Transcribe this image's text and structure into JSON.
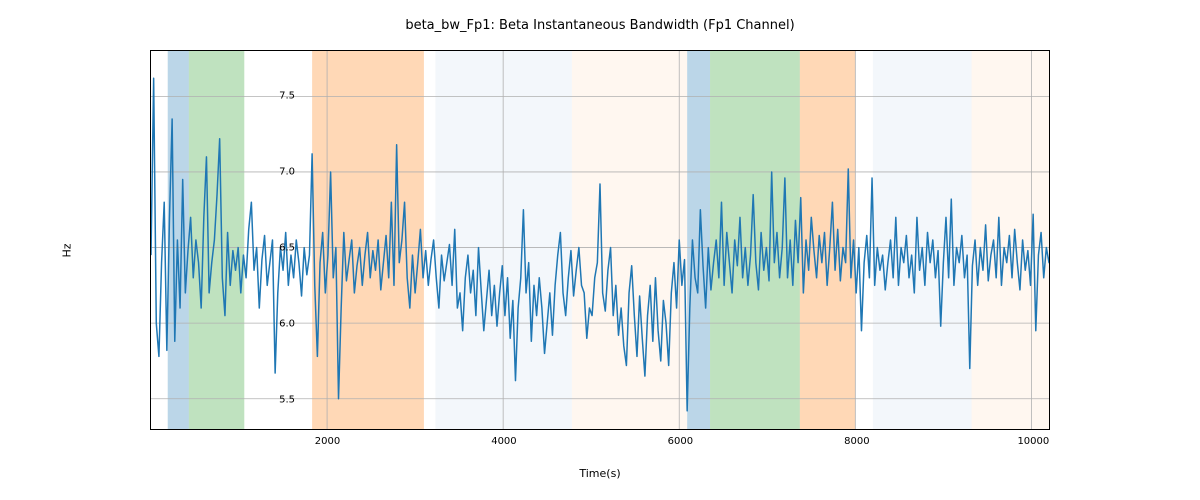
{
  "chart_data": {
    "type": "line",
    "title": "beta_bw_Fp1: Beta Instantaneous Bandwidth (Fp1 Channel)",
    "xlabel": "Time(s)",
    "ylabel": "Hz",
    "xlim": [
      0,
      10200
    ],
    "ylim": [
      5.3,
      7.8
    ],
    "xticks": [
      2000,
      4000,
      6000,
      8000,
      10000
    ],
    "yticks": [
      5.5,
      6.0,
      6.5,
      7.0,
      7.5
    ],
    "grid": true,
    "bands": [
      {
        "x0": 190,
        "x1": 430,
        "color": "#1f77b4"
      },
      {
        "x0": 430,
        "x1": 1060,
        "color": "#2ca02c"
      },
      {
        "x0": 1060,
        "x1": 1740,
        "color": "#ffffff"
      },
      {
        "x0": 1830,
        "x1": 3100,
        "color": "#ff7f0e"
      },
      {
        "x0": 3230,
        "x1": 4780,
        "color": "#d6e5f3"
      },
      {
        "x0": 4780,
        "x1": 6090,
        "color": "#ffe5cc"
      },
      {
        "x0": 6090,
        "x1": 6350,
        "color": "#1f77b4"
      },
      {
        "x0": 6350,
        "x1": 7370,
        "color": "#2ca02c"
      },
      {
        "x0": 7370,
        "x1": 8000,
        "color": "#ff7f0e"
      },
      {
        "x0": 8200,
        "x1": 9320,
        "color": "#d6e5f3"
      },
      {
        "x0": 9320,
        "x1": 10200,
        "color": "#ffe5cc"
      }
    ],
    "series": [
      {
        "name": "beta_bw_Fp1",
        "color": "#1f77b4",
        "x_start": 0,
        "x_step": 30,
        "y": [
          6.45,
          7.62,
          6.0,
          5.78,
          6.4,
          6.8,
          5.82,
          6.7,
          7.35,
          5.88,
          6.55,
          6.1,
          6.95,
          6.2,
          6.48,
          6.7,
          6.3,
          6.55,
          6.4,
          6.1,
          6.7,
          7.1,
          6.2,
          6.4,
          6.55,
          6.85,
          7.22,
          6.3,
          6.05,
          6.6,
          6.25,
          6.48,
          6.35,
          6.5,
          6.2,
          6.45,
          6.3,
          6.62,
          6.8,
          6.35,
          6.5,
          6.1,
          6.42,
          6.58,
          6.25,
          6.4,
          6.55,
          5.67,
          6.2,
          6.5,
          6.35,
          6.6,
          6.25,
          6.45,
          6.3,
          6.55,
          6.4,
          6.18,
          6.5,
          6.32,
          6.45,
          7.12,
          6.25,
          5.78,
          6.4,
          6.6,
          6.2,
          6.45,
          7.0,
          6.3,
          6.5,
          5.5,
          6.1,
          6.6,
          6.28,
          6.42,
          6.55,
          6.2,
          6.38,
          6.5,
          6.25,
          6.45,
          6.6,
          6.3,
          6.48,
          6.35,
          6.55,
          6.22,
          6.4,
          6.58,
          6.3,
          6.8,
          6.25,
          7.18,
          6.4,
          6.55,
          6.8,
          6.3,
          6.1,
          6.45,
          6.2,
          6.4,
          6.62,
          6.3,
          6.48,
          6.25,
          6.42,
          6.55,
          6.3,
          6.1,
          6.45,
          6.28,
          6.4,
          6.52,
          6.25,
          6.62,
          6.1,
          6.2,
          5.95,
          6.3,
          6.45,
          6.2,
          6.35,
          6.05,
          6.5,
          6.22,
          5.95,
          6.15,
          6.35,
          6.05,
          6.25,
          5.98,
          6.2,
          6.38,
          6.05,
          6.3,
          5.9,
          6.15,
          5.62,
          6.1,
          6.3,
          6.75,
          6.2,
          6.4,
          5.88,
          6.25,
          6.05,
          6.3,
          6.1,
          5.8,
          6.0,
          6.2,
          5.92,
          6.25,
          6.45,
          6.6,
          6.2,
          6.05,
          6.3,
          6.48,
          6.18,
          6.35,
          6.5,
          6.25,
          6.2,
          5.9,
          6.1,
          6.05,
          6.3,
          6.4,
          6.92,
          6.2,
          6.08,
          6.35,
          6.5,
          6.05,
          6.25,
          5.92,
          6.1,
          5.85,
          5.72,
          6.2,
          6.38,
          6.05,
          5.78,
          6.18,
          5.9,
          5.65,
          6.05,
          6.25,
          5.88,
          6.3,
          5.95,
          5.75,
          6.15,
          6.0,
          5.72,
          6.2,
          6.4,
          6.1,
          6.55,
          6.25,
          6.42,
          5.42,
          6.1,
          6.55,
          6.3,
          6.2,
          6.75,
          6.38,
          6.1,
          6.5,
          6.22,
          6.4,
          6.55,
          6.3,
          6.8,
          6.25,
          6.6,
          6.4,
          6.2,
          6.55,
          6.38,
          6.7,
          6.3,
          6.5,
          6.25,
          6.45,
          6.85,
          6.4,
          6.22,
          6.6,
          6.35,
          6.5,
          6.28,
          7.0,
          6.4,
          6.6,
          6.3,
          6.5,
          6.96,
          6.3,
          6.55,
          6.25,
          6.68,
          6.4,
          6.83,
          6.2,
          6.55,
          6.35,
          6.7,
          6.48,
          6.3,
          6.58,
          6.4,
          6.6,
          6.25,
          6.5,
          6.8,
          6.35,
          6.62,
          6.28,
          6.5,
          6.4,
          7.02,
          6.3,
          6.55,
          6.2,
          6.5,
          5.95,
          6.4,
          6.58,
          6.3,
          6.96,
          6.25,
          6.5,
          6.35,
          6.45,
          6.22,
          6.4,
          6.55,
          6.3,
          6.7,
          6.25,
          6.5,
          6.4,
          6.58,
          6.3,
          6.45,
          6.2,
          6.7,
          6.35,
          6.5,
          6.25,
          6.6,
          6.4,
          6.55,
          6.3,
          6.48,
          5.98,
          6.4,
          6.7,
          6.3,
          6.82,
          6.25,
          6.5,
          6.4,
          6.58,
          6.3,
          6.45,
          5.7,
          6.38,
          6.55,
          6.25,
          6.5,
          6.35,
          6.65,
          6.28,
          6.45,
          6.55,
          6.3,
          6.7,
          6.25,
          6.5,
          6.4,
          6.58,
          6.3,
          6.62,
          6.4,
          6.22,
          6.55,
          6.35,
          6.48,
          6.25,
          6.72,
          5.95,
          6.45,
          6.6,
          6.3,
          6.5,
          6.4,
          6.55,
          6.28,
          6.42,
          6.58,
          6.3
        ]
      }
    ]
  }
}
